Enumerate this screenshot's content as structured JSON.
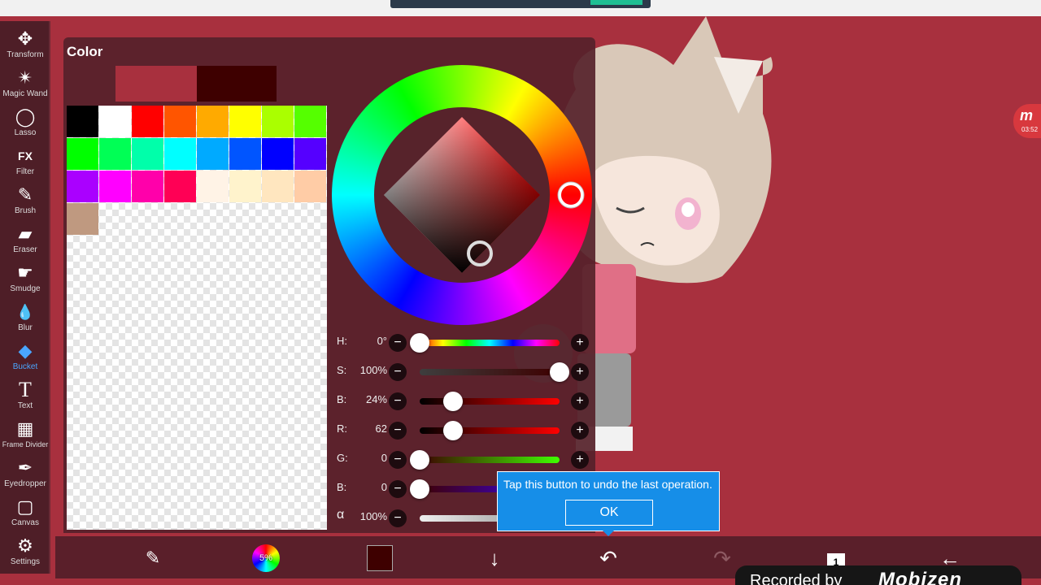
{
  "toolbar": {
    "items": [
      {
        "label": "Transform",
        "icon": "move-arrows-icon",
        "glyph": "✥"
      },
      {
        "label": "Magic Wand",
        "icon": "magic-wand-icon",
        "glyph": "✴"
      },
      {
        "label": "Lasso",
        "icon": "lasso-icon",
        "glyph": "◯"
      },
      {
        "label": "Filter",
        "icon": "fx-icon",
        "glyph": "FX"
      },
      {
        "label": "Brush",
        "icon": "brush-icon",
        "glyph": "✎"
      },
      {
        "label": "Eraser",
        "icon": "eraser-icon",
        "glyph": "▰"
      },
      {
        "label": "Smudge",
        "icon": "smudge-icon",
        "glyph": "☛"
      },
      {
        "label": "Blur",
        "icon": "drop-icon",
        "glyph": "💧"
      },
      {
        "label": "Bucket",
        "icon": "bucket-icon",
        "glyph": "◆"
      },
      {
        "label": "Text",
        "icon": "text-icon",
        "glyph": "T"
      },
      {
        "label": "Frame Divider",
        "icon": "frame-divider-icon",
        "glyph": "▦"
      },
      {
        "label": "Eyedropper",
        "icon": "eyedropper-icon",
        "glyph": "✒"
      },
      {
        "label": "Canvas",
        "icon": "canvas-icon",
        "glyph": "▢"
      },
      {
        "label": "Settings",
        "icon": "gear-icon",
        "glyph": "⚙"
      }
    ],
    "active": "Bucket"
  },
  "color_panel": {
    "title": "Color",
    "current_color": "#a8303e",
    "previous_color": "#3e0000",
    "palette": [
      "#000000",
      "#ffffff",
      "#ff0000",
      "#ff5500",
      "#ffaa00",
      "#ffff00",
      "#aaff00",
      "#55ff00",
      "#00ff00",
      "#00ff55",
      "#00ffaa",
      "#00ffff",
      "#00aaff",
      "#0055ff",
      "#0000ff",
      "#5500ff",
      "#aa00ff",
      "#ff00ff",
      "#ff00aa",
      "#ff0055",
      "#fff3e6",
      "#fff3cc",
      "#ffe6bf",
      "#ffcca6",
      "#bf9980"
    ],
    "sliders": [
      {
        "label": "H:",
        "value": "0°",
        "level": 0.0,
        "track": "hue"
      },
      {
        "label": "S:",
        "value": "100%",
        "level": 1.0,
        "track": "sat"
      },
      {
        "label": "B:",
        "value": "24%",
        "level": 0.24,
        "track": "bright"
      },
      {
        "label": "R:",
        "value": "62",
        "level": 0.24,
        "track": "red"
      },
      {
        "label": "G:",
        "value": "0",
        "level": 0.0,
        "track": "green"
      },
      {
        "label": "B:",
        "value": "0",
        "level": 0.0,
        "track": "blue"
      },
      {
        "label": "α",
        "value": "100%",
        "level": 1.0,
        "track": "alpha"
      }
    ]
  },
  "tooltip": {
    "text": "Tap this button to undo the last operation.",
    "ok_label": "OK"
  },
  "bottom_bar": {
    "color_wheel_percent": "5%",
    "layers_count": "1"
  },
  "side_badge": {
    "time": "03:52"
  },
  "watermark": {
    "text": "Recorded by",
    "logo": "Mobizen"
  }
}
